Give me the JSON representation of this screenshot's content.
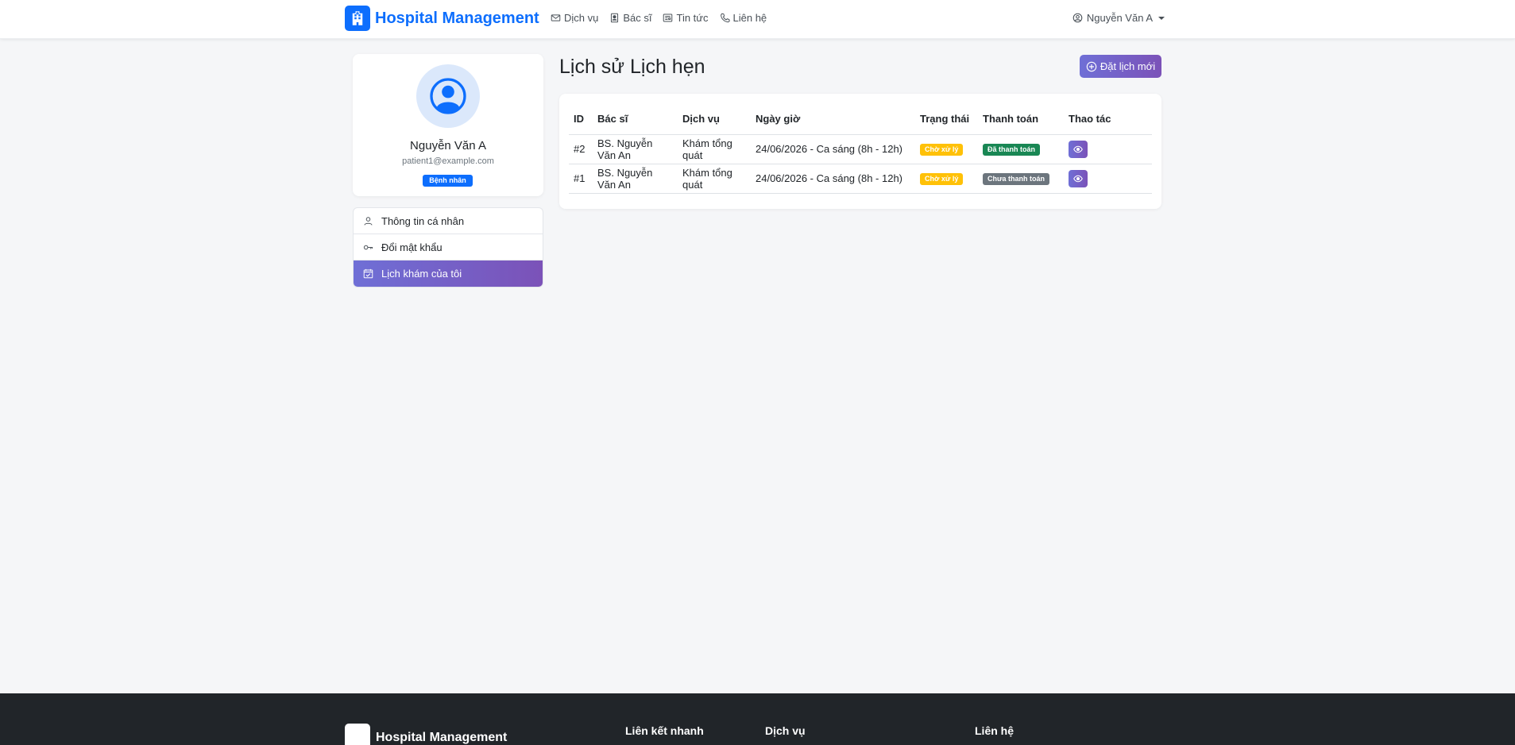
{
  "navbar": {
    "brand": "Hospital Management",
    "links": [
      {
        "label": "Dịch vụ",
        "icon": "envelope-icon"
      },
      {
        "label": "Bác sĩ",
        "icon": "id-badge-icon"
      },
      {
        "label": "Tin tức",
        "icon": "newspaper-icon"
      },
      {
        "label": "Liên hệ",
        "icon": "phone-icon"
      }
    ],
    "user": "Nguyễn Văn A"
  },
  "profile": {
    "name": "Nguyễn Văn A",
    "email": "patient1@example.com",
    "role": "Bệnh nhân"
  },
  "side_menu": [
    {
      "label": "Thông tin cá nhân",
      "icon": "person-icon",
      "active": false
    },
    {
      "label": "Đổi mật khẩu",
      "icon": "key-icon",
      "active": false
    },
    {
      "label": "Lịch khám của tôi",
      "icon": "calendar-check-icon",
      "active": true
    }
  ],
  "main": {
    "title": "Lịch sử Lịch hẹn",
    "new_button": "Đặt lịch mới",
    "table": {
      "headers": [
        "ID",
        "Bác sĩ",
        "Dịch vụ",
        "Ngày giờ",
        "Trạng thái",
        "Thanh toán",
        "Thao tác"
      ],
      "rows": [
        {
          "id": "#2",
          "doctor": "BS. Nguyễn Văn An",
          "service": "Khám tổng quát",
          "datetime": "24/06/2026 - Ca sáng (8h - 12h)",
          "status": "Chờ xử lý",
          "payment": "Đã thanh toán",
          "payment_color": "#198754"
        },
        {
          "id": "#1",
          "doctor": "BS. Nguyễn Văn An",
          "service": "Khám tổng quát",
          "datetime": "24/06/2026 - Ca sáng (8h - 12h)",
          "status": "Chờ xử lý",
          "payment": "Chưa thanh toán",
          "payment_color": "#6c757d"
        }
      ]
    }
  },
  "footer": {
    "brand": "Hospital Management",
    "columns": [
      "Liên kết nhanh",
      "Dịch vụ",
      "Liên hệ"
    ]
  },
  "colors": {
    "primary": "#0d6efd",
    "accent_gradient_start": "#6f6fd6",
    "accent_gradient_end": "#7b52b8",
    "warning": "#ffc107"
  }
}
